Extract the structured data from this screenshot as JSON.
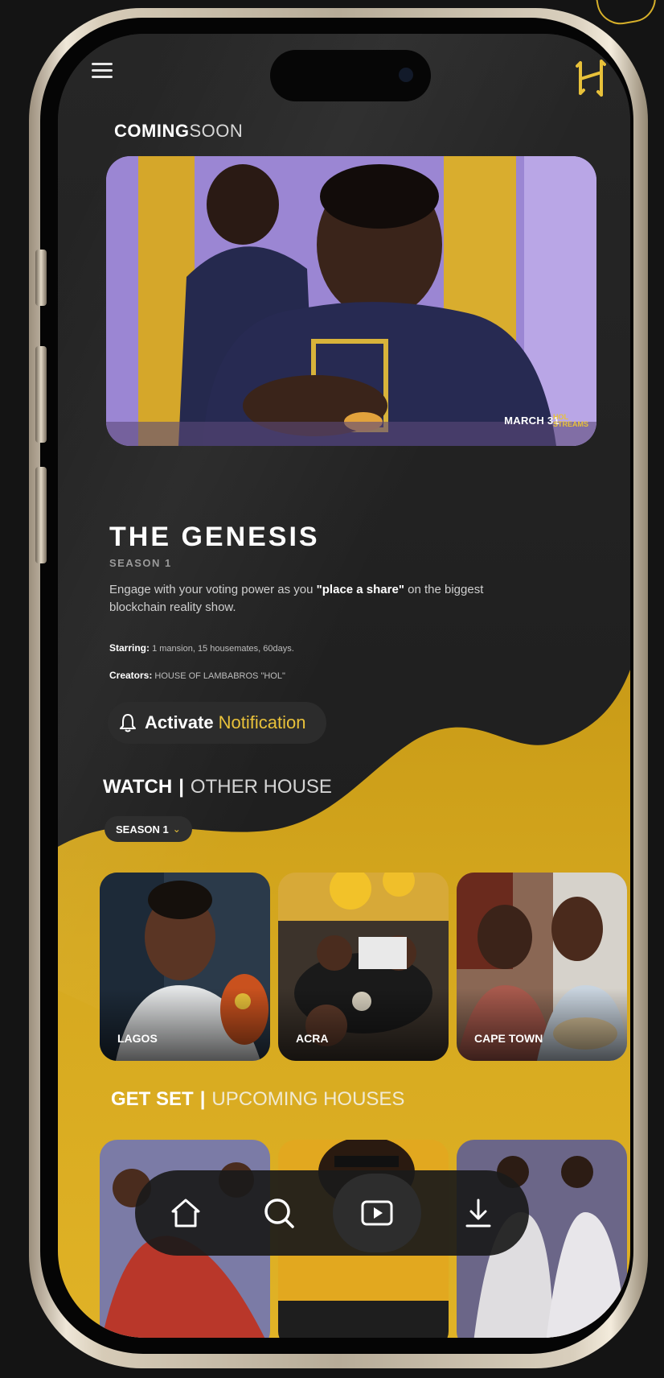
{
  "app": {
    "brand_logo": "H-logo",
    "menu_icon": "hamburger-menu-icon"
  },
  "header": {
    "coming_bold": "COMING",
    "coming_light": "SOON"
  },
  "hero": {
    "date_text": "MARCH 31",
    "mark_text": "HOL STREAMS"
  },
  "show": {
    "title": "THE GENESIS",
    "season": "SEASON 1",
    "description_prefix": "Engage with your voting power as you ",
    "description_bold": "\"place a share\"",
    "description_suffix": " on the biggest blockchain reality show.",
    "starring_label": "Starring:",
    "starring_value": "1 mansion, 15 housemates, 60days.",
    "creators_label": "Creators:",
    "creators_value": "HOUSE OF LAMBABROS \"HOL\""
  },
  "notify": {
    "word_bold": "Activate",
    "word_accent": "Notification"
  },
  "watch": {
    "bold": "WATCH",
    "separator": "|",
    "light": "OTHER HOUSE"
  },
  "season_select": {
    "label": "SEASON 1",
    "caret": "⌄"
  },
  "houses": [
    {
      "label": "LAGOS"
    },
    {
      "label": "ACRA"
    },
    {
      "label": "CAPE TOWN"
    }
  ],
  "getset": {
    "bold": "GET SET",
    "separator": "|",
    "light": "UPCOMING HOUSES"
  },
  "nav": {
    "items": [
      "home-icon",
      "search-icon",
      "play-icon",
      "download-icon"
    ],
    "active_index": 2
  },
  "colors": {
    "accent_gold": "#e8c13a",
    "background": "#1d1d1d"
  }
}
